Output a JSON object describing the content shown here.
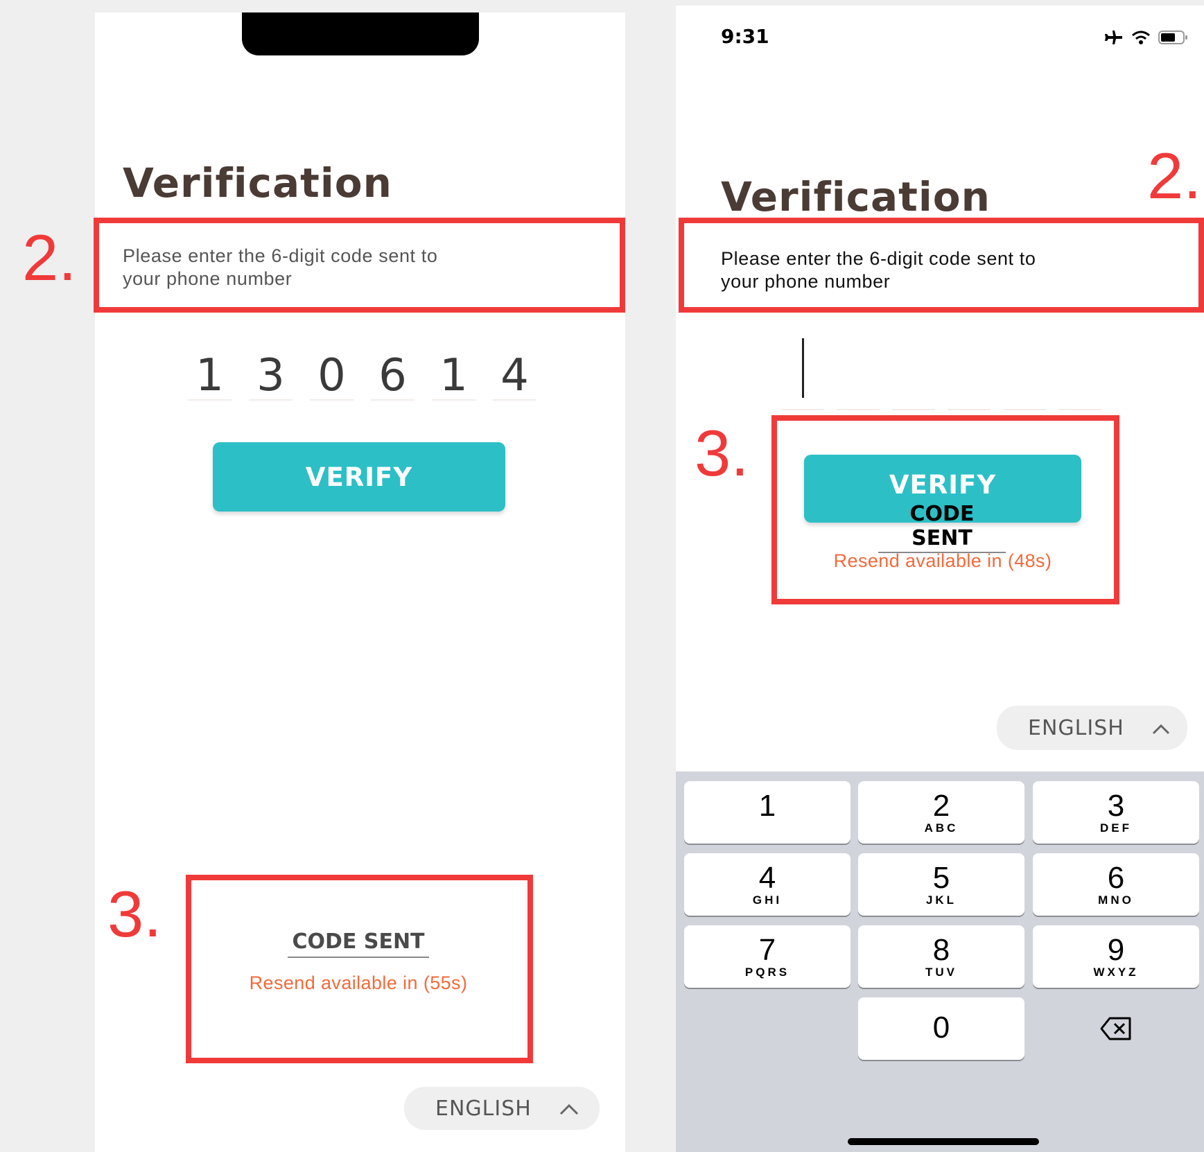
{
  "left": {
    "title": "Verification",
    "instruction_line1": "Please enter the 6-digit code sent to",
    "instruction_line2": "your phone number",
    "code_digits": [
      "1",
      "3",
      "0",
      "6",
      "1",
      "4"
    ],
    "verify_label": "VERIFY",
    "code_sent_label": "CODE SENT",
    "resend_text": "Resend available in (55s)",
    "language": "ENGLISH"
  },
  "right": {
    "status_time": "9:31",
    "title": "Verification",
    "instruction_line1": "Please enter the 6-digit code sent to",
    "instruction_line2": "your phone number",
    "verify_label": "VERIFY",
    "code_sent_label": "CODE SENT",
    "resend_text": "Resend available in (48s)",
    "language": "ENGLISH",
    "keypad": [
      {
        "num": "1",
        "letters": ""
      },
      {
        "num": "2",
        "letters": "ABC"
      },
      {
        "num": "3",
        "letters": "DEF"
      },
      {
        "num": "4",
        "letters": "GHI"
      },
      {
        "num": "5",
        "letters": "JKL"
      },
      {
        "num": "6",
        "letters": "MNO"
      },
      {
        "num": "7",
        "letters": "PQRS"
      },
      {
        "num": "8",
        "letters": "TUV"
      },
      {
        "num": "9",
        "letters": "WXYZ"
      },
      {
        "num": "0",
        "letters": ""
      }
    ]
  },
  "annotations": {
    "label_2": "2.",
    "label_3": "3."
  },
  "colors": {
    "accent": "#2dbfc6",
    "resend": "#f26a3b",
    "annotation": "#f03a3a",
    "title": "#4a3b35"
  }
}
